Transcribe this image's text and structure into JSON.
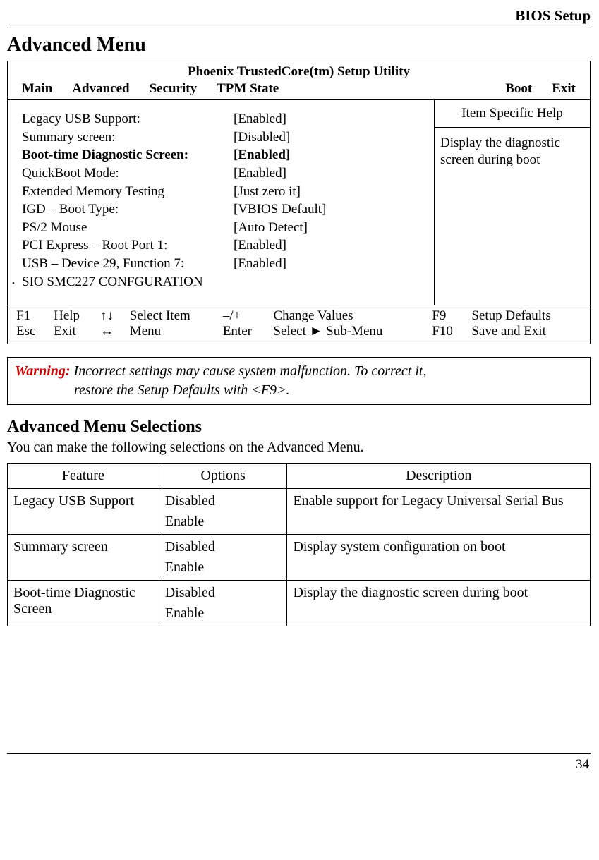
{
  "header": {
    "title": "BIOS Setup"
  },
  "section_heading": "Advanced Menu",
  "bios": {
    "title": "Phoenix TrustedCore(tm) Setup Utility",
    "tabs": [
      "Main",
      "Advanced",
      "Security",
      "TPM State",
      "Boot",
      "Exit"
    ],
    "settings": [
      {
        "label": "Legacy USB Support:",
        "value": "[Enabled]",
        "bold": false
      },
      {
        "label": "Summary screen:",
        "value": "[Disabled]",
        "bold": false
      },
      {
        "label": "Boot-time Diagnostic Screen:",
        "value": "[Enabled]",
        "bold": true
      },
      {
        "label": "QuickBoot Mode:",
        "value": "[Enabled]",
        "bold": false
      },
      {
        "label": "Extended Memory Testing",
        "value": "[Just zero it]",
        "bold": false
      },
      {
        "label": "IGD – Boot Type:",
        "value": " [VBIOS Default]",
        "bold": false
      },
      {
        "label": "PS/2 Mouse",
        "value": " [Auto Detect]",
        "bold": false
      },
      {
        "label": "PCI Express – Root Port 1:",
        "value": " [Enabled]",
        "bold": false
      },
      {
        "label": "USB – Device 29, Function 7:",
        "value": " [Enabled]",
        "bold": false
      }
    ],
    "submenu": "SIO SMC227 CONFGURATION",
    "help_title": "Item Specific Help",
    "help_text": "Display the diagnostic screen during boot",
    "footer": {
      "r1": {
        "k1": "F1",
        "a1": "Help",
        "sym1": "↑↓",
        "a2": "Select Item",
        "k2": "–/+",
        "a3": "Change Values",
        "k3": "F9",
        "a4": "Setup Defaults"
      },
      "r2": {
        "k1": "Esc",
        "a1": "Exit",
        "sym1": "↔",
        "a2": "Menu",
        "k2": "Enter",
        "a3": "Select ► Sub-Menu",
        "k3": "F10",
        "a4": "Save and Exit"
      }
    }
  },
  "warning": {
    "label": "Warning:",
    "line1": "Incorrect settings may cause system malfunction. To correct it,",
    "line2": "restore the Setup Defaults with <F9>."
  },
  "sub_heading": "Advanced Menu Selections",
  "sub_intro": "You can make the following selections on the Advanced Menu.",
  "table": {
    "headers": [
      "Feature",
      "Options",
      "Description"
    ],
    "rows": [
      {
        "feature": "Legacy USB Support",
        "options": [
          "Disabled",
          "Enable"
        ],
        "desc": "Enable support for Legacy Universal Serial Bus"
      },
      {
        "feature": "Summary screen",
        "options": [
          "Disabled",
          "Enable"
        ],
        "desc": "Display system configuration on boot"
      },
      {
        "feature": "Boot-time Diagnostic Screen",
        "options": [
          "Disabled",
          "Enable"
        ],
        "desc": "Display the diagnostic screen during boot"
      }
    ]
  },
  "page_number": "34"
}
